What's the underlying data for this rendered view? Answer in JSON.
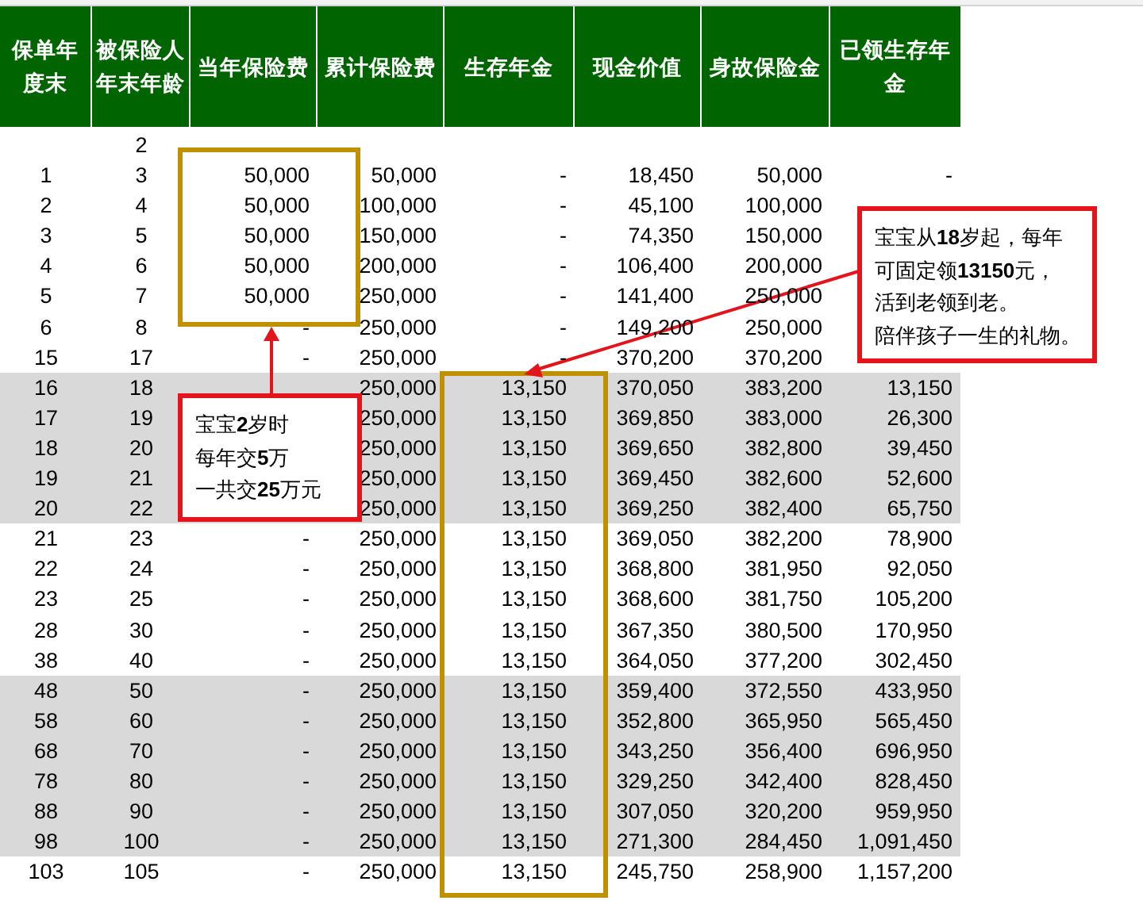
{
  "table": {
    "columns": [
      "保单年度末",
      "被保险人年末年龄",
      "当年保险费",
      "累计保险费",
      "生存年金",
      "现金价值",
      "身故保险金",
      "已领生存年金"
    ],
    "rows": [
      {
        "shaded": false,
        "cells": [
          null,
          "2",
          null,
          null,
          null,
          null,
          null,
          null
        ]
      },
      {
        "shaded": false,
        "cells": [
          "1",
          "3",
          "50,000",
          "50,000",
          "-",
          "18,450",
          "50,000",
          "-"
        ]
      },
      {
        "shaded": false,
        "cells": [
          "2",
          "4",
          "50,000",
          "100,000",
          "-",
          "45,100",
          "100,000",
          null
        ]
      },
      {
        "shaded": false,
        "cells": [
          "3",
          "5",
          "50,000",
          "150,000",
          "-",
          "74,350",
          "150,000",
          null
        ]
      },
      {
        "shaded": false,
        "cells": [
          "4",
          "6",
          "50,000",
          "200,000",
          "-",
          "106,400",
          "200,000",
          null
        ]
      },
      {
        "shaded": false,
        "cells": [
          "5",
          "7",
          "50,000",
          "250,000",
          "-",
          "141,400",
          "250,000",
          null
        ]
      },
      {
        "shaded": false,
        "cells": [
          "6",
          "8",
          "-",
          "250,000",
          "-",
          "149,200",
          "250,000",
          null
        ]
      },
      {
        "shaded": false,
        "cells": [
          "15",
          "17",
          "-",
          "250,000",
          "-",
          "370,200",
          "370,200",
          null
        ]
      },
      {
        "shaded": true,
        "cells": [
          "16",
          "18",
          null,
          "250,000",
          "13,150",
          "370,050",
          "383,200",
          "13,150"
        ]
      },
      {
        "shaded": true,
        "cells": [
          "17",
          "19",
          null,
          "250,000",
          "13,150",
          "369,850",
          "383,000",
          "26,300"
        ]
      },
      {
        "shaded": true,
        "cells": [
          "18",
          "20",
          null,
          "250,000",
          "13,150",
          "369,650",
          "382,800",
          "39,450"
        ]
      },
      {
        "shaded": true,
        "cells": [
          "19",
          "21",
          null,
          "250,000",
          "13,150",
          "369,450",
          "382,600",
          "52,600"
        ]
      },
      {
        "shaded": true,
        "cells": [
          "20",
          "22",
          null,
          "250,000",
          "13,150",
          "369,250",
          "382,400",
          "65,750"
        ]
      },
      {
        "shaded": false,
        "cells": [
          "21",
          "23",
          "-",
          "250,000",
          "13,150",
          "369,050",
          "382,200",
          "78,900"
        ]
      },
      {
        "shaded": false,
        "cells": [
          "22",
          "24",
          "-",
          "250,000",
          "13,150",
          "368,800",
          "381,950",
          "92,050"
        ]
      },
      {
        "shaded": false,
        "cells": [
          "23",
          "25",
          "-",
          "250,000",
          "13,150",
          "368,600",
          "381,750",
          "105,200"
        ]
      },
      {
        "shaded": false,
        "cells": [
          "28",
          "30",
          "-",
          "250,000",
          "13,150",
          "367,350",
          "380,500",
          "170,950"
        ]
      },
      {
        "shaded": false,
        "cells": [
          "38",
          "40",
          "-",
          "250,000",
          "13,150",
          "364,050",
          "377,200",
          "302,450"
        ]
      },
      {
        "shaded": true,
        "cells": [
          "48",
          "50",
          "-",
          "250,000",
          "13,150",
          "359,400",
          "372,550",
          "433,950"
        ]
      },
      {
        "shaded": true,
        "cells": [
          "58",
          "60",
          "-",
          "250,000",
          "13,150",
          "352,800",
          "365,950",
          "565,450"
        ]
      },
      {
        "shaded": true,
        "cells": [
          "68",
          "70",
          "-",
          "250,000",
          "13,150",
          "343,250",
          "356,400",
          "696,950"
        ]
      },
      {
        "shaded": true,
        "cells": [
          "78",
          "80",
          "-",
          "250,000",
          "13,150",
          "329,250",
          "342,400",
          "828,450"
        ]
      },
      {
        "shaded": true,
        "cells": [
          "88",
          "90",
          "-",
          "250,000",
          "13,150",
          "307,050",
          "320,200",
          "959,950"
        ]
      },
      {
        "shaded": true,
        "cells": [
          "98",
          "100",
          "-",
          "250,000",
          "13,150",
          "271,300",
          "284,450",
          "1,091,450"
        ]
      },
      {
        "shaded": false,
        "cells": [
          "103",
          "105",
          "-",
          "250,000",
          "13,150",
          "245,750",
          "258,900",
          "1,157,200"
        ]
      }
    ]
  },
  "callouts": [
    {
      "lines": [
        "宝宝从**18**岁起，每年",
        "可固定领**13150**元，",
        "活到老领到老。",
        "陪伴孩子一生的礼物。"
      ]
    },
    {
      "lines": [
        "宝宝**2**岁时",
        "每年交**5**万",
        "一共交**25**万元"
      ]
    }
  ]
}
